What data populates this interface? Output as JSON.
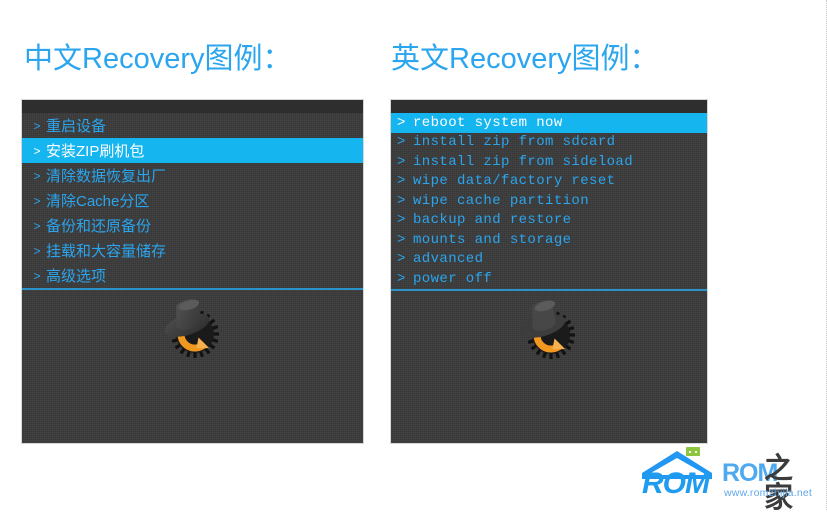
{
  "headings": {
    "chinese": "中文Recovery图例：",
    "english": "英文Recovery图例："
  },
  "colors": {
    "accent_blue": "#2aa5ee",
    "highlight_cyan": "#15b5f0",
    "panel_bg": "#3a3a3a",
    "panel_topbar": "#2e2e2e",
    "divider": "#2a93c9",
    "logo_orange": "#f39c2a",
    "page_bg": "#ffffff"
  },
  "chinese_recovery": {
    "prompt": ">",
    "selected_index": 1,
    "items": [
      {
        "label": "重启设备"
      },
      {
        "label": "安装ZIP刷机包"
      },
      {
        "label": "清除数据恢复出厂"
      },
      {
        "label": "清除Cache分区"
      },
      {
        "label": "备份和还原备份"
      },
      {
        "label": "挂载和大容量储存"
      },
      {
        "label": "高级选项"
      }
    ]
  },
  "english_recovery": {
    "prompt": ">",
    "selected_index": 0,
    "items": [
      {
        "label": "reboot system now"
      },
      {
        "label": "install zip from sdcard"
      },
      {
        "label": "install zip from sideload"
      },
      {
        "label": "wipe data/factory reset"
      },
      {
        "label": "wipe cache partition"
      },
      {
        "label": "backup and restore"
      },
      {
        "label": "mounts and storage"
      },
      {
        "label": "advanced"
      },
      {
        "label": "power off"
      }
    ]
  },
  "watermark": {
    "badge_text": "ROM",
    "brand_latin": "ROM",
    "brand_cn": "之家",
    "url": "www.romzhijia.net"
  }
}
